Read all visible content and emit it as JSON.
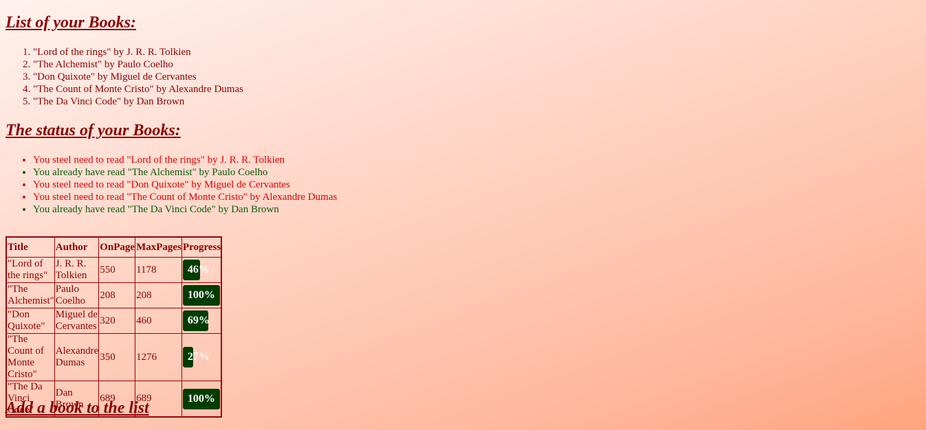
{
  "headings": {
    "list": "List of your Books:",
    "status": "The status of your Books:",
    "add": "Add a book to the list"
  },
  "books": [
    "\"Lord of the rings\" by J. R. R. Tolkien",
    "\"The Alchemist\" by Paulo Coelho",
    "\"Don Quixote\" by Miguel de Cervantes",
    "\"The Count of Monte Cristo\" by Alexandre Dumas",
    "\"The Da Vinci Code\" by Dan Brown"
  ],
  "status": [
    {
      "text": "You steel need to read \"Lord of the rings\" by J. R. R. Tolkien",
      "read": false
    },
    {
      "text": "You already have read \"The Alchemist\" by Paulo Coelho",
      "read": true
    },
    {
      "text": "You steel need to read \"Don Quixote\" by Miguel de Cervantes",
      "read": false
    },
    {
      "text": "You steel need to read \"The Count of Monte Cristo\" by Alexandre Dumas",
      "read": false
    },
    {
      "text": "You already have read \"The Da Vinci Code\" by Dan Brown",
      "read": true
    }
  ],
  "colors": {
    "unread": "#e00000",
    "read": "#0a5a0a",
    "progress_bar": "#003d00"
  },
  "table": {
    "headers": [
      "Title",
      "Author",
      "OnPage",
      "MaxPages",
      "Progress"
    ],
    "rows": [
      {
        "title": "\"Lord of the rings\"",
        "author": "J. R. R. Tolkien",
        "onpage": "550",
        "maxpages": "1178",
        "progress": "46%",
        "progress_value": 46
      },
      {
        "title": "\"The Alchemist\"",
        "author": "Paulo Coelho",
        "onpage": "208",
        "maxpages": "208",
        "progress": "100%",
        "progress_value": 100
      },
      {
        "title": "\"Don Quixote\"",
        "author": "Miguel de Cervantes",
        "onpage": "320",
        "maxpages": "460",
        "progress": "69%",
        "progress_value": 69
      },
      {
        "title": "\"The Count of Monte Cristo\"",
        "author": "Alexandre Dumas",
        "onpage": "350",
        "maxpages": "1276",
        "progress": "27%",
        "progress_value": 27
      },
      {
        "title": "\"The Da Vinci Code\"",
        "author": "Dan Brown",
        "onpage": "689",
        "maxpages": "689",
        "progress": "100%",
        "progress_value": 100
      }
    ]
  }
}
